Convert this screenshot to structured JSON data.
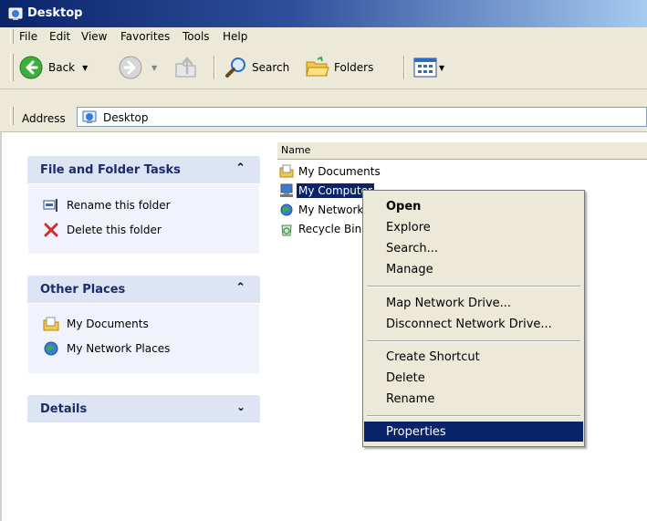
{
  "window": {
    "title": "Desktop"
  },
  "menubar": {
    "items": [
      "File",
      "Edit",
      "View",
      "Favorites",
      "Tools",
      "Help"
    ]
  },
  "toolbar": {
    "back_label": "Back",
    "search_label": "Search",
    "folders_label": "Folders"
  },
  "address": {
    "label": "Address",
    "value": "Desktop"
  },
  "tasks_panel": {
    "title": "File and Folder Tasks",
    "links": [
      "Rename this folder",
      "Delete this folder"
    ]
  },
  "places_panel": {
    "title": "Other Places",
    "links": [
      "My Documents",
      "My Network Places"
    ]
  },
  "details_panel": {
    "title": "Details"
  },
  "file_list": {
    "column_header": "Name",
    "items": [
      "My Documents",
      "My Computer",
      "My Network Places",
      "Recycle Bin"
    ],
    "selected_index": 1
  },
  "context_menu": {
    "items": [
      "Open",
      "Explore",
      "Search...",
      "Manage",
      "Map Network Drive...",
      "Disconnect Network Drive...",
      "Create Shortcut",
      "Delete",
      "Rename",
      "Properties"
    ],
    "default_index": 0,
    "highlighted_index": 9
  },
  "colors": {
    "title_bar": "#0a246a",
    "selection": "#0a246a",
    "chrome": "#ece9d8",
    "panel_head": "#dde4f4"
  }
}
